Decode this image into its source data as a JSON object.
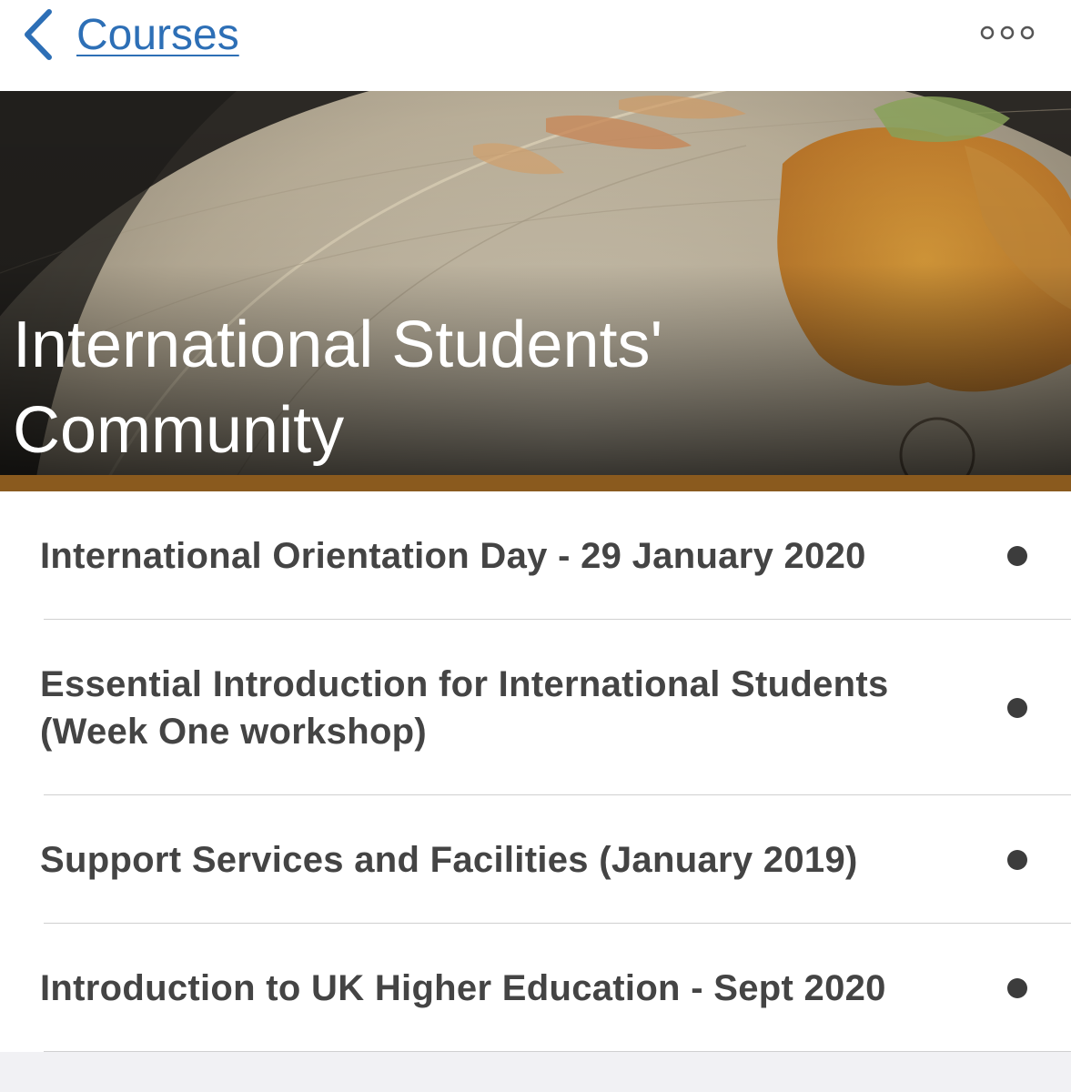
{
  "nav": {
    "back_label": "Courses",
    "back_icon": "chevron-left-icon",
    "more_icon": "more-options-icon"
  },
  "hero": {
    "title_line1": "International Students'",
    "title_line2": "Community",
    "accent_color": "#8a5a1e"
  },
  "courses": {
    "items": [
      {
        "label": "International Orientation Day - 29 January 2020"
      },
      {
        "label": "Essential Introduction for International Students (Week One workshop)"
      },
      {
        "label": "Support Services and Facilities (January 2019)"
      },
      {
        "label": "Introduction to UK Higher Education - Sept 2020"
      }
    ]
  },
  "colors": {
    "link": "#2d6fb6",
    "text": "#444444",
    "dot": "#3c3c3c"
  }
}
